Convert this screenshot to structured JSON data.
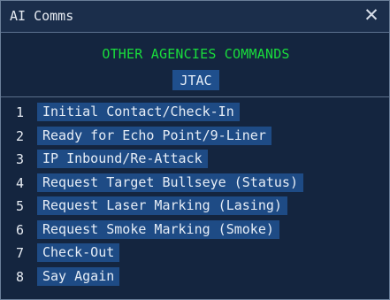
{
  "window": {
    "title": "AI Comms",
    "close_glyph": "✕"
  },
  "header": {
    "heading": "OTHER AGENCIES COMMANDS",
    "badge": "JTAC"
  },
  "menu": {
    "items": [
      {
        "num": "1",
        "label": "Initial Contact/Check-In"
      },
      {
        "num": "2",
        "label": "Ready for Echo Point/9-Liner"
      },
      {
        "num": "3",
        "label": "IP Inbound/Re-Attack"
      },
      {
        "num": "4",
        "label": "Request Target Bullseye (Status)"
      },
      {
        "num": "5",
        "label": "Request Laser Marking (Lasing)"
      },
      {
        "num": "6",
        "label": "Request Smoke Marking (Smoke)"
      },
      {
        "num": "7",
        "label": "Check-Out"
      },
      {
        "num": "8",
        "label": "Say Again"
      }
    ]
  },
  "colors": {
    "heading_green": "#19dd3c",
    "item_highlight": "#1e4b85",
    "background": "#14253f"
  }
}
